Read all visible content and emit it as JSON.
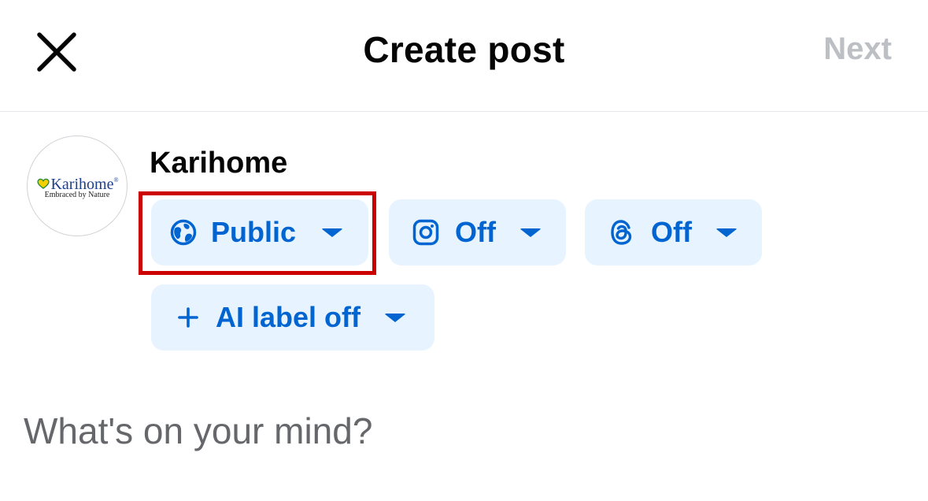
{
  "header": {
    "title": "Create post",
    "next_label": "Next",
    "close_icon": "close-icon"
  },
  "profile": {
    "name": "Karihome",
    "avatar": {
      "brand": "Karihome",
      "registered_mark": "®",
      "tagline": "Embraced by Nature"
    }
  },
  "chips": {
    "audience": {
      "icon": "globe-icon",
      "label": "Public"
    },
    "instagram": {
      "icon": "instagram-icon",
      "label": "Off"
    },
    "threads": {
      "icon": "threads-icon",
      "label": "Off"
    },
    "ai_label": {
      "icon": "plus-icon",
      "label": "AI label off"
    }
  },
  "composer": {
    "placeholder": "What's on your mind?"
  },
  "colors": {
    "accent": "#0064d1",
    "chip_background": "#e7f3ff",
    "highlight": "#cc0000",
    "next_disabled": "#bcc0c4",
    "placeholder": "#65676b"
  }
}
